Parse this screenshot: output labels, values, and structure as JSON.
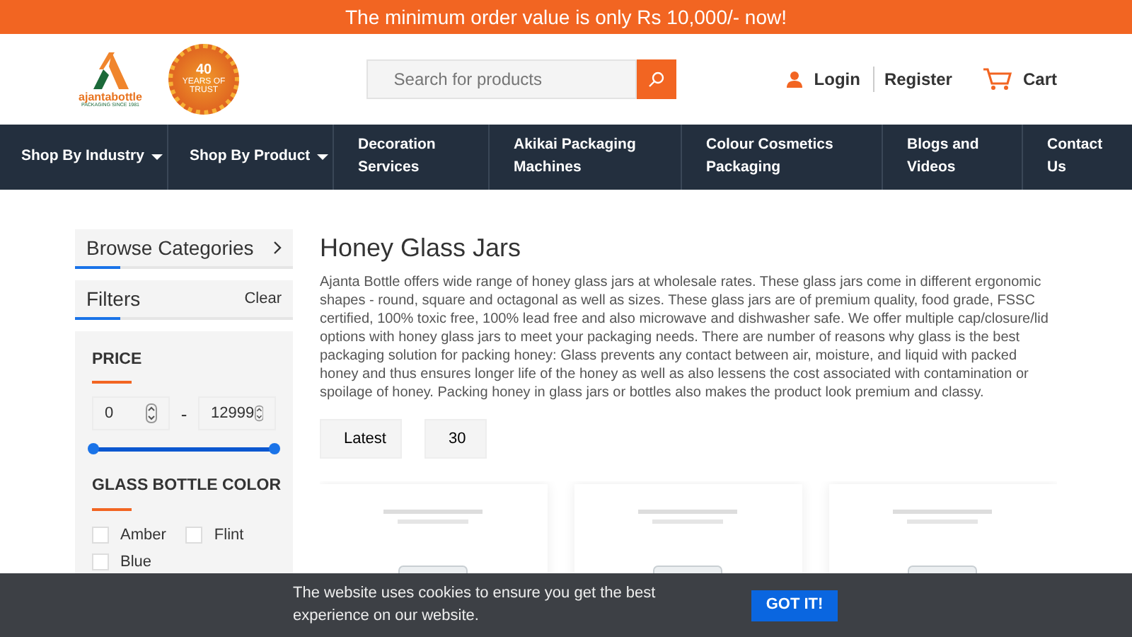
{
  "promo_bar": {
    "text": "The minimum order value is only Rs 10,000/- now!"
  },
  "header": {
    "logo": {
      "name": "ajantabottle",
      "tagline": "PACKAGING SINCE 1981"
    },
    "badge": {
      "number": "40",
      "text": "YEARS OF TRUST"
    },
    "search": {
      "placeholder": "Search for products"
    },
    "links": [
      {
        "kind": "login",
        "label": "Login"
      },
      {
        "kind": "register",
        "label": "Register"
      },
      {
        "kind": "cart",
        "label": "Cart"
      }
    ]
  },
  "nav": [
    {
      "label": "Shop By Industry",
      "dropdown": true
    },
    {
      "label": "Shop By Product",
      "dropdown": true
    },
    {
      "label": "Decoration Services",
      "dropdown": false
    },
    {
      "label": "Akikai Packaging Machines",
      "dropdown": false
    },
    {
      "label": "Colour Cosmetics Packaging",
      "dropdown": false
    },
    {
      "label": "Blogs and Videos",
      "dropdown": false
    },
    {
      "label": "Contact Us",
      "dropdown": false
    }
  ],
  "sidebar": {
    "browse": "Browse Categories",
    "filters": {
      "title": "Filters",
      "clear": "Clear"
    },
    "price": {
      "title": "PRICE",
      "min": "0",
      "separator": "-",
      "max": "12999",
      "level": 1
    },
    "color": {
      "title": "GLASS BOTTLE COLOR",
      "options": [
        {
          "label": "Amber",
          "checked": false
        },
        {
          "label": "Flint",
          "checked": false
        },
        {
          "label": "Blue",
          "checked": false
        }
      ]
    }
  },
  "main": {
    "title": "Honey Glass Jars",
    "description": "Ajanta Bottle offers wide range of honey glass jars at wholesale rates. These glass jars come in different ergonomic shapes - round, square and octagonal as well as sizes. These glass jars are of premium quality, food grade, FSSC certified, 100% toxic free, 100% lead free and also microwave and dishwasher safe. We offer multiple cap/closure/lid options with honey glass jars to meet your packaging needs. There are number of reasons why glass is the best packaging solution for packing honey: Glass prevents any contact between air, moisture, and liquid with packed honey and thus ensures longer life of the honey as well as also lessens the cost associated with contamination or spoilage of honey. Packing honey in glass jars or bottles also makes the product look premium and classy.",
    "sort": "Latest",
    "per_page": "30"
  },
  "cookie_banner": {
    "text": "The website uses cookies to ensure you get the best experience on our website.",
    "button": "GOT IT!"
  }
}
